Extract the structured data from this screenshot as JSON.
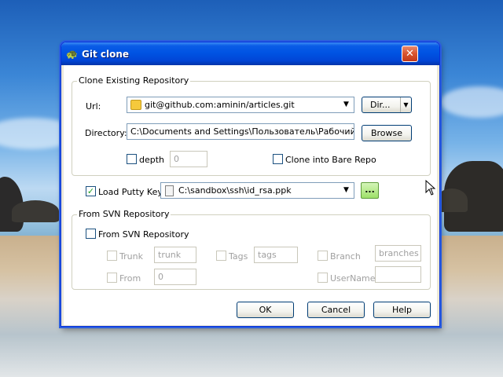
{
  "window": {
    "title": "Git clone",
    "close_label": "✕"
  },
  "clone_group": {
    "title": "Clone Existing Repository",
    "url_label": "Url:",
    "url_value": "git@github.com:aminin/articles.git",
    "dir_button": "Dir...",
    "directory_label": "Directory:",
    "directory_value": "C:\\Documents and Settings\\Пользователь\\Рабочий стол\\articles",
    "browse_button": "Browse",
    "depth_label": "depth",
    "depth_value": "0",
    "bare_label": "Clone into Bare Repo"
  },
  "putty": {
    "label": "Load Putty Key",
    "key_value": "C:\\sandbox\\ssh\\id_rsa.ppk",
    "browse_label": "..."
  },
  "svn_group": {
    "title": "From SVN Repository",
    "checkbox_label": "From SVN Repository",
    "trunk_label": "Trunk",
    "trunk_value": "trunk",
    "tags_label": "Tags",
    "tags_value": "tags",
    "branch_label": "Branch",
    "branch_value": "branches",
    "from_label": "From",
    "from_value": "0",
    "username_label": "UserName",
    "username_value": ""
  },
  "buttons": {
    "ok": "OK",
    "cancel": "Cancel",
    "help": "Help"
  },
  "icons": {
    "title": "git-turtle-icon",
    "url": "folder-icon",
    "key": "key-file-icon",
    "dropdown": "chevron-down-icon"
  },
  "colors": {
    "titlebar": "#0054e3",
    "close": "#d8542f",
    "dialog_bg": "#ece9d8",
    "check": "#21a121"
  }
}
